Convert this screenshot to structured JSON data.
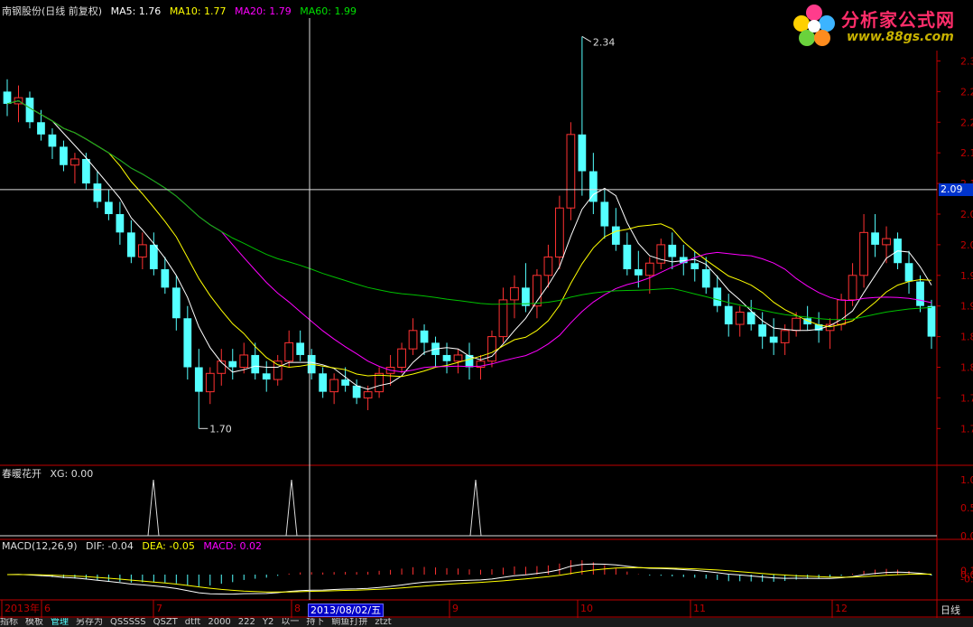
{
  "header": {
    "stock": "南钢股份(日线 前复权)",
    "ma5": "MA5: 1.76",
    "ma10": "MA10: 1.77",
    "ma20": "MA20: 1.79",
    "ma60": "MA60: 1.99"
  },
  "indicator": {
    "name": "春暖花开",
    "value": "XG: 0.00"
  },
  "macd": {
    "name": "MACD(12,26,9)",
    "dif": "DIF: -0.04",
    "dea": "DEA: -0.05",
    "macd": "MACD: 0.02"
  },
  "logo": {
    "brand": "分析家公式网",
    "url": "www.88gs.com"
  },
  "crosshair": {
    "date": "2013/08/02/五",
    "price": "2.09"
  },
  "period_label": "日线",
  "bottom_bar": [
    "指标",
    "模板",
    "管理",
    "另存为",
    "QSSSSS",
    "QSZT",
    "dtft",
    "2000",
    "222",
    "Y2",
    "以一",
    "持下",
    "鲷鱼打拼",
    "ztzt"
  ],
  "colors": {
    "up": "#ff3232",
    "down": "#54ffff",
    "ma5": "#ffffff",
    "ma10": "#ffff00",
    "ma20": "#ff00ff",
    "ma60": "#00c000",
    "axis": "#c00000"
  },
  "chart_data": [
    {
      "type": "candlestick",
      "title": "南钢股份(日线 前复权)",
      "price_ticks": [
        "2.3",
        "2.2",
        "2.2",
        "2.1",
        "2.1",
        "2.0",
        "2.0",
        "1.9",
        "1.9",
        "1.8",
        "1.8",
        "1.7",
        "1.7"
      ],
      "ylim": [
        1.64,
        2.37
      ],
      "date_ticks": [
        "2013年",
        "6",
        "7",
        "8",
        "9",
        "10",
        "11",
        "12"
      ],
      "annotations": {
        "high": 2.34,
        "low": 1.7
      },
      "series_colors": {
        "MA5": "#ffffff",
        "MA10": "#ffff00",
        "MA20": "#ff00ff",
        "MA60": "#00c000"
      },
      "ohlc": [
        [
          2.25,
          2.27,
          2.21,
          2.23
        ],
        [
          2.23,
          2.26,
          2.2,
          2.24
        ],
        [
          2.24,
          2.25,
          2.19,
          2.2
        ],
        [
          2.2,
          2.22,
          2.17,
          2.18
        ],
        [
          2.18,
          2.19,
          2.14,
          2.16
        ],
        [
          2.16,
          2.17,
          2.12,
          2.13
        ],
        [
          2.13,
          2.15,
          2.1,
          2.14
        ],
        [
          2.14,
          2.15,
          2.09,
          2.1
        ],
        [
          2.1,
          2.12,
          2.06,
          2.07
        ],
        [
          2.07,
          2.09,
          2.04,
          2.05
        ],
        [
          2.05,
          2.07,
          2.0,
          2.02
        ],
        [
          2.02,
          2.04,
          1.97,
          1.98
        ],
        [
          1.98,
          2.02,
          1.96,
          2.0
        ],
        [
          2.0,
          2.02,
          1.95,
          1.96
        ],
        [
          1.96,
          1.98,
          1.92,
          1.93
        ],
        [
          1.93,
          1.95,
          1.86,
          1.88
        ],
        [
          1.88,
          1.9,
          1.78,
          1.8
        ],
        [
          1.8,
          1.83,
          1.7,
          1.76
        ],
        [
          1.76,
          1.8,
          1.74,
          1.79
        ],
        [
          1.79,
          1.83,
          1.77,
          1.81
        ],
        [
          1.81,
          1.83,
          1.78,
          1.8
        ],
        [
          1.8,
          1.84,
          1.79,
          1.82
        ],
        [
          1.82,
          1.84,
          1.78,
          1.79
        ],
        [
          1.79,
          1.81,
          1.76,
          1.78
        ],
        [
          1.78,
          1.82,
          1.77,
          1.81
        ],
        [
          1.81,
          1.86,
          1.8,
          1.84
        ],
        [
          1.84,
          1.86,
          1.81,
          1.82
        ],
        [
          1.82,
          1.83,
          1.78,
          1.79
        ],
        [
          1.79,
          1.8,
          1.75,
          1.76
        ],
        [
          1.76,
          1.79,
          1.74,
          1.78
        ],
        [
          1.78,
          1.8,
          1.76,
          1.77
        ],
        [
          1.77,
          1.78,
          1.74,
          1.75
        ],
        [
          1.75,
          1.77,
          1.73,
          1.76
        ],
        [
          1.76,
          1.8,
          1.75,
          1.79
        ],
        [
          1.79,
          1.82,
          1.77,
          1.8
        ],
        [
          1.8,
          1.84,
          1.79,
          1.83
        ],
        [
          1.83,
          1.88,
          1.82,
          1.86
        ],
        [
          1.86,
          1.87,
          1.82,
          1.84
        ],
        [
          1.84,
          1.85,
          1.8,
          1.82
        ],
        [
          1.82,
          1.84,
          1.79,
          1.81
        ],
        [
          1.81,
          1.83,
          1.79,
          1.82
        ],
        [
          1.82,
          1.84,
          1.78,
          1.8
        ],
        [
          1.8,
          1.82,
          1.78,
          1.81
        ],
        [
          1.81,
          1.86,
          1.8,
          1.85
        ],
        [
          1.85,
          1.93,
          1.84,
          1.91
        ],
        [
          1.91,
          1.95,
          1.88,
          1.93
        ],
        [
          1.93,
          1.97,
          1.89,
          1.9
        ],
        [
          1.9,
          1.96,
          1.88,
          1.95
        ],
        [
          1.95,
          2.0,
          1.93,
          1.98
        ],
        [
          1.98,
          2.08,
          1.96,
          2.06
        ],
        [
          2.06,
          2.2,
          2.04,
          2.18
        ],
        [
          2.18,
          2.34,
          2.08,
          2.12
        ],
        [
          2.12,
          2.15,
          2.05,
          2.07
        ],
        [
          2.07,
          2.09,
          2.01,
          2.03
        ],
        [
          2.03,
          2.06,
          1.99,
          2.0
        ],
        [
          2.0,
          2.02,
          1.95,
          1.96
        ],
        [
          1.96,
          1.99,
          1.93,
          1.95
        ],
        [
          1.95,
          1.98,
          1.92,
          1.97
        ],
        [
          1.97,
          2.01,
          1.96,
          2.0
        ],
        [
          2.0,
          2.02,
          1.96,
          1.98
        ],
        [
          1.98,
          2.0,
          1.95,
          1.97
        ],
        [
          1.97,
          1.99,
          1.94,
          1.96
        ],
        [
          1.96,
          1.98,
          1.92,
          1.93
        ],
        [
          1.93,
          1.95,
          1.89,
          1.9
        ],
        [
          1.9,
          1.92,
          1.85,
          1.87
        ],
        [
          1.87,
          1.9,
          1.85,
          1.89
        ],
        [
          1.89,
          1.91,
          1.86,
          1.87
        ],
        [
          1.87,
          1.89,
          1.83,
          1.85
        ],
        [
          1.85,
          1.88,
          1.82,
          1.84
        ],
        [
          1.84,
          1.87,
          1.82,
          1.86
        ],
        [
          1.86,
          1.89,
          1.85,
          1.88
        ],
        [
          1.88,
          1.9,
          1.86,
          1.87
        ],
        [
          1.87,
          1.89,
          1.84,
          1.86
        ],
        [
          1.86,
          1.88,
          1.83,
          1.87
        ],
        [
          1.87,
          1.92,
          1.86,
          1.91
        ],
        [
          1.91,
          1.97,
          1.9,
          1.95
        ],
        [
          1.95,
          2.05,
          1.93,
          2.02
        ],
        [
          2.02,
          2.05,
          1.98,
          2.0
        ],
        [
          2.0,
          2.03,
          1.97,
          2.01
        ],
        [
          2.01,
          2.02,
          1.96,
          1.97
        ],
        [
          1.97,
          1.99,
          1.92,
          1.94
        ],
        [
          1.94,
          1.95,
          1.89,
          1.9
        ],
        [
          1.9,
          1.91,
          1.83,
          1.85
        ]
      ]
    },
    {
      "type": "line",
      "title": "春暖花开",
      "series": [
        {
          "name": "XG",
          "values": [
            0,
            0,
            0,
            0,
            0,
            0,
            0,
            0,
            0,
            0,
            0,
            0,
            0,
            0,
            0,
            0,
            0,
            0,
            0,
            0,
            0,
            0,
            0,
            0,
            0,
            0,
            0,
            0,
            0,
            0,
            0,
            0,
            0,
            0,
            0,
            0,
            0,
            0,
            0,
            0,
            0,
            0,
            0,
            0,
            0,
            0,
            0,
            0,
            0,
            0,
            0,
            0,
            0,
            0,
            0,
            0,
            0,
            0,
            0,
            0,
            0,
            0,
            0,
            0,
            0,
            0,
            0,
            0,
            0,
            0,
            0,
            0,
            0,
            0,
            0,
            0,
            0,
            0,
            0,
            0,
            0,
            0,
            0,
            0
          ]
        }
      ],
      "spikes_at_x_px": [],
      "spikes": [
        1,
        1,
        1
      ],
      "yticks": [
        "1.0",
        "0.5",
        "0.0"
      ],
      "ylim": [
        0,
        1.1
      ]
    },
    {
      "type": "bar",
      "title": "MACD(12,26,9)",
      "series_names": [
        "DIF",
        "DEA",
        "MACD"
      ],
      "yticks": [
        "0.1",
        "0.0",
        "-0.1"
      ],
      "ylim": [
        -0.12,
        0.12
      ]
    }
  ]
}
